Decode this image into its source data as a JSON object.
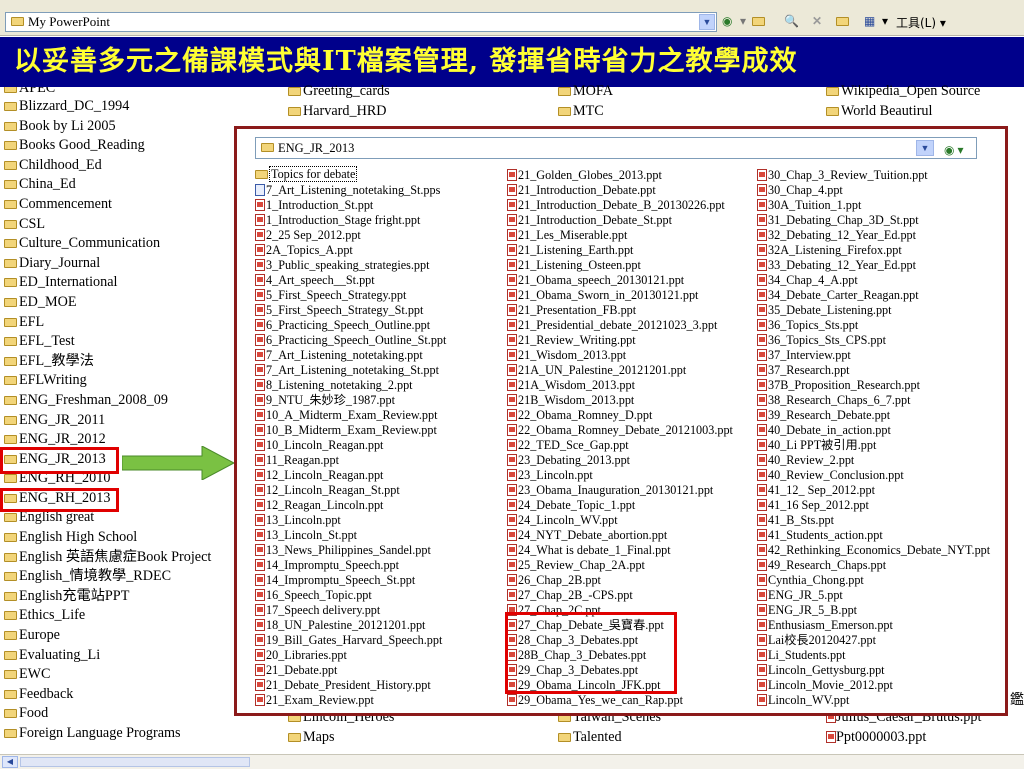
{
  "address_bar": {
    "path": "My PowerPoint",
    "tools_label": "工具(L)"
  },
  "banner": {
    "title": "以妥善多元之備課模式與IT檔案管理, 發揮省時省力之教學成效"
  },
  "background": {
    "col1_top_cut": "APEC",
    "col1": [
      "Blizzard_DC_1994",
      "Book by Li 2005",
      "Books Good_Reading",
      "Childhood_Ed",
      "China_Ed",
      "Commencement",
      "CSL",
      "Culture_Communication",
      "Diary_Journal",
      "ED_International",
      "ED_MOE",
      "EFL",
      "EFL_Test",
      "EFL_教學法",
      "EFLWriting",
      "ENG_Freshman_2008_09",
      "ENG_JR_2011",
      "ENG_JR_2012",
      "ENG_JR_2013",
      "ENG_RH_2010",
      "ENG_RH_2013",
      "English great",
      "English High School",
      "English 英語焦慮症Book Project",
      "English_情境教學_RDEC",
      "English充電站PPT",
      "Ethics_Life",
      "Europe",
      "Evaluating_Li",
      "EWC",
      "Feedback",
      "Food",
      "Foreign Language Programs"
    ],
    "col2_top": [
      "Greeting_cards",
      "Harvard_HRD"
    ],
    "col2_bottom": [
      "Lincoln_Heroes",
      "Maps"
    ],
    "col3_top": [
      "MOFA",
      "MTC"
    ],
    "col3_bottom": [
      "Taiwan_Scenes",
      "Talented"
    ],
    "col4_top": [
      "Wikipedia_Open Source",
      "World Beautirul"
    ],
    "col4_bottom": [
      "Julius_Caesar_Brutus.ppt",
      "Ppt0000003.ppt"
    ],
    "right_cut": "鑑"
  },
  "window": {
    "path": "ENG_JR_2013",
    "col1": [
      {
        "icon": "folder",
        "name": "Topics for debate"
      },
      {
        "icon": "pps",
        "name": "7_Art_Listening_notetaking_St.pps"
      },
      {
        "icon": "ppt",
        "name": "1_Introduction_St.ppt"
      },
      {
        "icon": "ppt",
        "name": "1_Introduction_Stage fright.ppt"
      },
      {
        "icon": "ppt",
        "name": "2_25 Sep_2012.ppt"
      },
      {
        "icon": "ppt",
        "name": "2A_Topics_A.ppt"
      },
      {
        "icon": "ppt",
        "name": "3_Public_speaking_strategies.ppt"
      },
      {
        "icon": "ppt",
        "name": "4_Art_speech__St.ppt"
      },
      {
        "icon": "ppt",
        "name": "5_First_Speech_Strategy.ppt"
      },
      {
        "icon": "ppt",
        "name": "5_First_Speech_Strategy_St.ppt"
      },
      {
        "icon": "ppt",
        "name": "6_Practicing_Speech_Outline.ppt"
      },
      {
        "icon": "ppt",
        "name": "6_Practicing_Speech_Outline_St.ppt"
      },
      {
        "icon": "ppt",
        "name": "7_Art_Listening_notetaking.ppt"
      },
      {
        "icon": "ppt",
        "name": "7_Art_Listening_notetaking_St.ppt"
      },
      {
        "icon": "ppt",
        "name": "8_Listening_notetaking_2.ppt"
      },
      {
        "icon": "ppt",
        "name": "9_NTU_朱妙珍_1987.ppt"
      },
      {
        "icon": "ppt",
        "name": "10_A_Midterm_Exam_Review.ppt"
      },
      {
        "icon": "ppt",
        "name": "10_B_Midterm_Exam_Review.ppt"
      },
      {
        "icon": "ppt",
        "name": "10_Lincoln_Reagan.ppt"
      },
      {
        "icon": "ppt",
        "name": "11_Reagan.ppt"
      },
      {
        "icon": "ppt",
        "name": "12_Lincoln_Reagan.ppt"
      },
      {
        "icon": "ppt",
        "name": "12_Lincoln_Reagan_St.ppt"
      },
      {
        "icon": "ppt",
        "name": "12_Reagan_Lincoln.ppt"
      },
      {
        "icon": "ppt",
        "name": "13_Lincoln.ppt"
      },
      {
        "icon": "ppt",
        "name": "13_Lincoln_St.ppt"
      },
      {
        "icon": "ppt",
        "name": "13_News_Philippines_Sandel.ppt"
      },
      {
        "icon": "ppt",
        "name": "14_Impromptu_Speech.ppt"
      },
      {
        "icon": "ppt",
        "name": "14_Impromptu_Speech_St.ppt"
      },
      {
        "icon": "ppt",
        "name": "16_Speech_Topic.ppt"
      },
      {
        "icon": "ppt",
        "name": "17_Speech delivery.ppt"
      },
      {
        "icon": "ppt",
        "name": "18_UN_Palestine_20121201.ppt"
      },
      {
        "icon": "ppt",
        "name": "19_Bill_Gates_Harvard_Speech.ppt"
      },
      {
        "icon": "ppt",
        "name": "20_Libraries.ppt"
      },
      {
        "icon": "ppt",
        "name": "21_Debate.ppt"
      },
      {
        "icon": "ppt",
        "name": "21_Debate_President_History.ppt"
      },
      {
        "icon": "ppt",
        "name": "21_Exam_Review.ppt"
      }
    ],
    "col2": [
      {
        "icon": "ppt",
        "name": "21_Golden_Globes_2013.ppt"
      },
      {
        "icon": "ppt",
        "name": "21_Introduction_Debate.ppt"
      },
      {
        "icon": "ppt",
        "name": "21_Introduction_Debate_B_20130226.ppt"
      },
      {
        "icon": "ppt",
        "name": "21_Introduction_Debate_St.ppt"
      },
      {
        "icon": "ppt",
        "name": "21_Les_Miserable.ppt"
      },
      {
        "icon": "ppt",
        "name": "21_Listening_Earth.ppt"
      },
      {
        "icon": "ppt",
        "name": "21_Listening_Osteen.ppt"
      },
      {
        "icon": "ppt",
        "name": "21_Obama_speech_20130121.ppt"
      },
      {
        "icon": "ppt",
        "name": "21_Obama_Sworn_in_20130121.ppt"
      },
      {
        "icon": "ppt",
        "name": "21_Presentation_FB.ppt"
      },
      {
        "icon": "ppt",
        "name": "21_Presidential_debate_20121023_3.ppt"
      },
      {
        "icon": "ppt",
        "name": "21_Review_Writing.ppt"
      },
      {
        "icon": "ppt",
        "name": "21_Wisdom_2013.ppt"
      },
      {
        "icon": "ppt",
        "name": "21A_UN_Palestine_20121201.ppt"
      },
      {
        "icon": "ppt",
        "name": "21A_Wisdom_2013.ppt"
      },
      {
        "icon": "ppt",
        "name": "21B_Wisdom_2013.ppt"
      },
      {
        "icon": "ppt",
        "name": "22_Obama_Romney_D.ppt"
      },
      {
        "icon": "ppt",
        "name": "22_Obama_Romney_Debate_20121003.ppt"
      },
      {
        "icon": "ppt",
        "name": "22_TED_Sce_Gap.ppt"
      },
      {
        "icon": "ppt",
        "name": "23_Debating_2013.ppt"
      },
      {
        "icon": "ppt",
        "name": "23_Lincoln.ppt"
      },
      {
        "icon": "ppt",
        "name": "23_Obama_Inauguration_20130121.ppt"
      },
      {
        "icon": "ppt",
        "name": "24_Debate_Topic_1.ppt"
      },
      {
        "icon": "ppt",
        "name": "24_Lincoln_WV.ppt"
      },
      {
        "icon": "ppt",
        "name": "24_NYT_Debate_abortion.ppt"
      },
      {
        "icon": "ppt",
        "name": "24_What is debate_1_Final.ppt"
      },
      {
        "icon": "ppt",
        "name": "25_Review_Chap_2A.ppt"
      },
      {
        "icon": "ppt",
        "name": "26_Chap_2B.ppt"
      },
      {
        "icon": "ppt",
        "name": "27_Chap_2B_-CPS.ppt"
      },
      {
        "icon": "ppt",
        "name": "27_Chap_2C.ppt"
      },
      {
        "icon": "ppt",
        "name": "27_Chap_Debate_吳寶春.ppt"
      },
      {
        "icon": "ppt",
        "name": "28_Chap_3_Debates.ppt"
      },
      {
        "icon": "ppt",
        "name": "28B_Chap_3_Debates.ppt"
      },
      {
        "icon": "ppt",
        "name": "29_Chap_3_Debates.ppt"
      },
      {
        "icon": "ppt",
        "name": "29_Obama_Lincoln_JFK.ppt"
      },
      {
        "icon": "ppt",
        "name": "29_Obama_Yes_we_can_Rap.ppt"
      }
    ],
    "col3": [
      {
        "icon": "ppt",
        "name": "30_Chap_3_Review_Tuition.ppt"
      },
      {
        "icon": "ppt",
        "name": "30_Chap_4.ppt"
      },
      {
        "icon": "ppt",
        "name": "30A_Tuition_1.ppt"
      },
      {
        "icon": "ppt",
        "name": "31_Debating_Chap_3D_St.ppt"
      },
      {
        "icon": "ppt",
        "name": "32_Debating_12_Year_Ed.ppt"
      },
      {
        "icon": "ppt",
        "name": "32A_Listening_Firefox.ppt"
      },
      {
        "icon": "ppt",
        "name": "33_Debating_12_Year_Ed.ppt"
      },
      {
        "icon": "ppt",
        "name": "34_Chap_4_A.ppt"
      },
      {
        "icon": "ppt",
        "name": "34_Debate_Carter_Reagan.ppt"
      },
      {
        "icon": "ppt",
        "name": "35_Debate_Listening.ppt"
      },
      {
        "icon": "ppt",
        "name": "36_Topics_Sts.ppt"
      },
      {
        "icon": "ppt",
        "name": "36_Topics_Sts_CPS.ppt"
      },
      {
        "icon": "ppt",
        "name": "37_Interview.ppt"
      },
      {
        "icon": "ppt",
        "name": "37_Research.ppt"
      },
      {
        "icon": "ppt",
        "name": "37B_Proposition_Research.ppt"
      },
      {
        "icon": "ppt",
        "name": "38_Research_Chaps_6_7.ppt"
      },
      {
        "icon": "ppt",
        "name": "39_Research_Debate.ppt"
      },
      {
        "icon": "ppt",
        "name": "40_Debate_in_action.ppt"
      },
      {
        "icon": "ppt",
        "name": "40_Li PPT被引用.ppt"
      },
      {
        "icon": "ppt",
        "name": "40_Review_2.ppt"
      },
      {
        "icon": "ppt",
        "name": "40_Review_Conclusion.ppt"
      },
      {
        "icon": "ppt",
        "name": "41_12_ Sep_2012.ppt"
      },
      {
        "icon": "ppt",
        "name": "41_16 Sep_2012.ppt"
      },
      {
        "icon": "ppt",
        "name": "41_B_Sts.ppt"
      },
      {
        "icon": "ppt",
        "name": "41_Students_action.ppt"
      },
      {
        "icon": "ppt",
        "name": "42_Rethinking_Economics_Debate_NYT.ppt"
      },
      {
        "icon": "ppt",
        "name": "49_Research_Chaps.ppt"
      },
      {
        "icon": "ppt",
        "name": "Cynthia_Chong.ppt"
      },
      {
        "icon": "ppt",
        "name": "ENG_JR_5.ppt"
      },
      {
        "icon": "ppt",
        "name": "ENG_JR_5_B.ppt"
      },
      {
        "icon": "ppt",
        "name": "Enthusiasm_Emerson.ppt"
      },
      {
        "icon": "ppt",
        "name": "Lai校長20120427.ppt"
      },
      {
        "icon": "ppt",
        "name": "Li_Students.ppt"
      },
      {
        "icon": "ppt",
        "name": "Lincoln_Gettysburg.ppt"
      },
      {
        "icon": "ppt",
        "name": "Lincoln_Movie_2012.ppt"
      },
      {
        "icon": "ppt",
        "name": "Lincoln_WV.ppt"
      }
    ]
  },
  "colors": {
    "banner_bg": "#00008b",
    "banner_text": "#ffff33",
    "highlight": "#e00000",
    "window_border": "#8b1a1a",
    "arrow": "#7ac143"
  }
}
